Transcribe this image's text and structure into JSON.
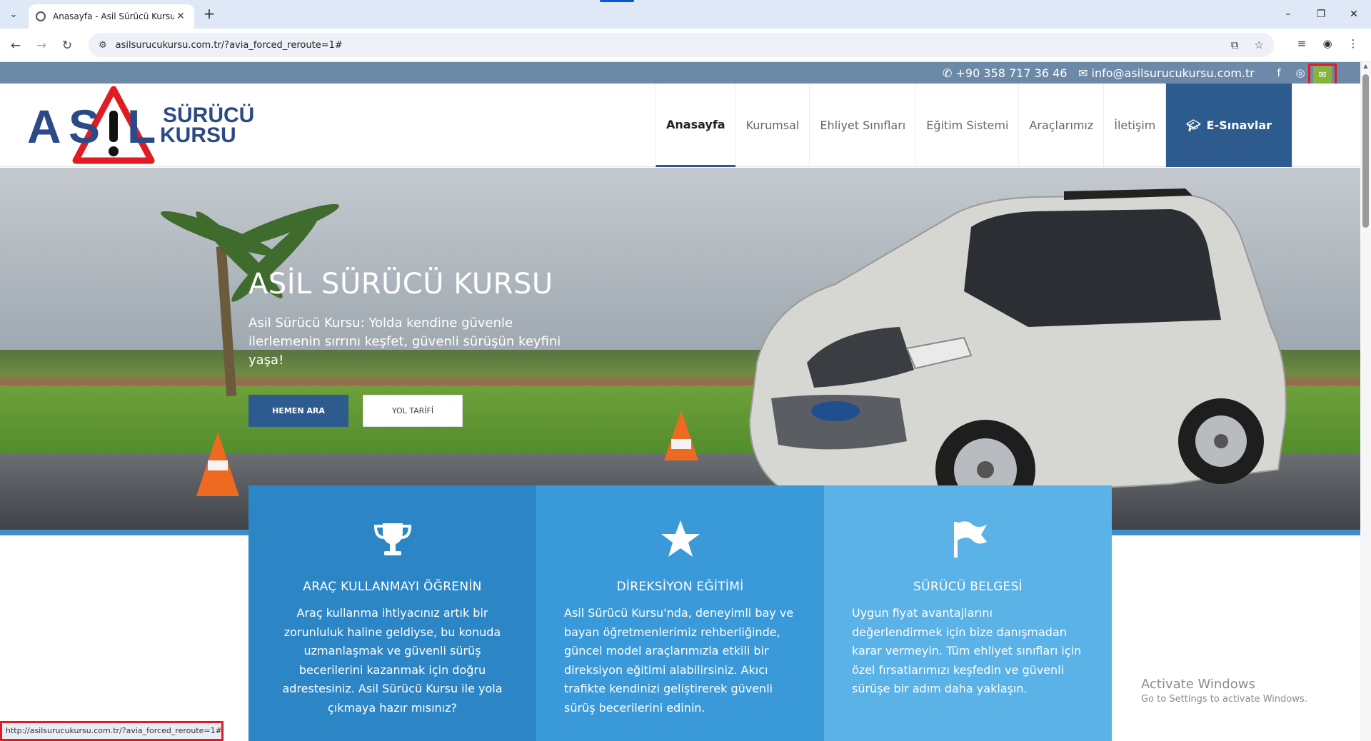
{
  "browser": {
    "tab_title": "Anasayfa - Asil Sürücü Kursu",
    "tab_close": "✕",
    "new_tab": "+",
    "url": "asilsurucukursu.com.tr/?avia_forced_reroute=1#",
    "status_url": "http://asilsurucukursu.com.tr/?avia_forced_reroute=1#",
    "window_controls": {
      "minimize": "–",
      "restore": "❐",
      "close": "✕"
    }
  },
  "topbar": {
    "phone": "+90 358 717 36 46",
    "email": "info@asilsurucukursu.com.tr",
    "social": [
      "facebook-icon",
      "instagram-icon",
      "mail-icon"
    ]
  },
  "logo": {
    "letter_a": "A",
    "letter_s": "S",
    "letter_l": "L",
    "word1": "SÜRÜCÜ",
    "word2": "KURSU"
  },
  "menu": {
    "items": [
      {
        "label": "Anasayfa",
        "active": true
      },
      {
        "label": "Kurumsal"
      },
      {
        "label": "Ehliyet Sınıfları"
      },
      {
        "label": "Eğitim Sistemi"
      },
      {
        "label": "Araçlarımız"
      },
      {
        "label": "İletişim"
      }
    ],
    "cta_label": "E-Sınavlar"
  },
  "hero": {
    "title": "ASİL SÜRÜCÜ KURSU",
    "subtitle": "Asil Sürücü Kursu: Yolda kendine güvenle ilerlemenin sırrını keşfet, güvenli sürüşün keyfini yaşa!",
    "btn_call": "HEMEN ARA",
    "btn_directions": "YOL TARİFİ"
  },
  "features": [
    {
      "icon": "trophy-icon",
      "title": "ARAÇ KULLANMAYI ÖĞRENİN",
      "text": "Araç kullanma ihtiyacınız artık bir zorunluluk haline geldiyse, bu konuda uzmanlaşmak ve güvenli sürüş becerilerini kazanmak için doğru adrestesiniz. Asil Sürücü Kursu ile yola çıkmaya hazır mısınız?"
    },
    {
      "icon": "star-icon",
      "title": "DİREKSİYON EĞİTİMİ",
      "text": "Asil Sürücü Kursu'nda, deneyimli bay ve bayan öğretmenlerimiz rehberliğinde, güncel model araçlarımızla etkili bir direksiyon eğitimi alabilirsiniz. Akıcı trafikte kendinizi geliştirerek güvenli sürüş becerilerini edinin."
    },
    {
      "icon": "flag-icon",
      "title": "SÜRÜCÜ BELGESİ",
      "text": "Uygun fiyat avantajlarını değerlendirmek için bize danışmadan karar vermeyin. Tüm ehliyet sınıfları için özel fırsatlarımızı keşfedin ve güvenli sürüşe bir adım daha yaklaşın."
    }
  ],
  "watermark": {
    "line1": "Activate Windows",
    "line2": "Go to Settings to activate Windows."
  },
  "colors": {
    "brand_blue": "#2d5b8e",
    "topbar": "#6c8aa8",
    "feature1": "#2c86c6",
    "feature2": "#3a9ad9",
    "feature3": "#5ab2e6",
    "mail_green": "#88b43d",
    "highlight_red": "#e21b23"
  }
}
